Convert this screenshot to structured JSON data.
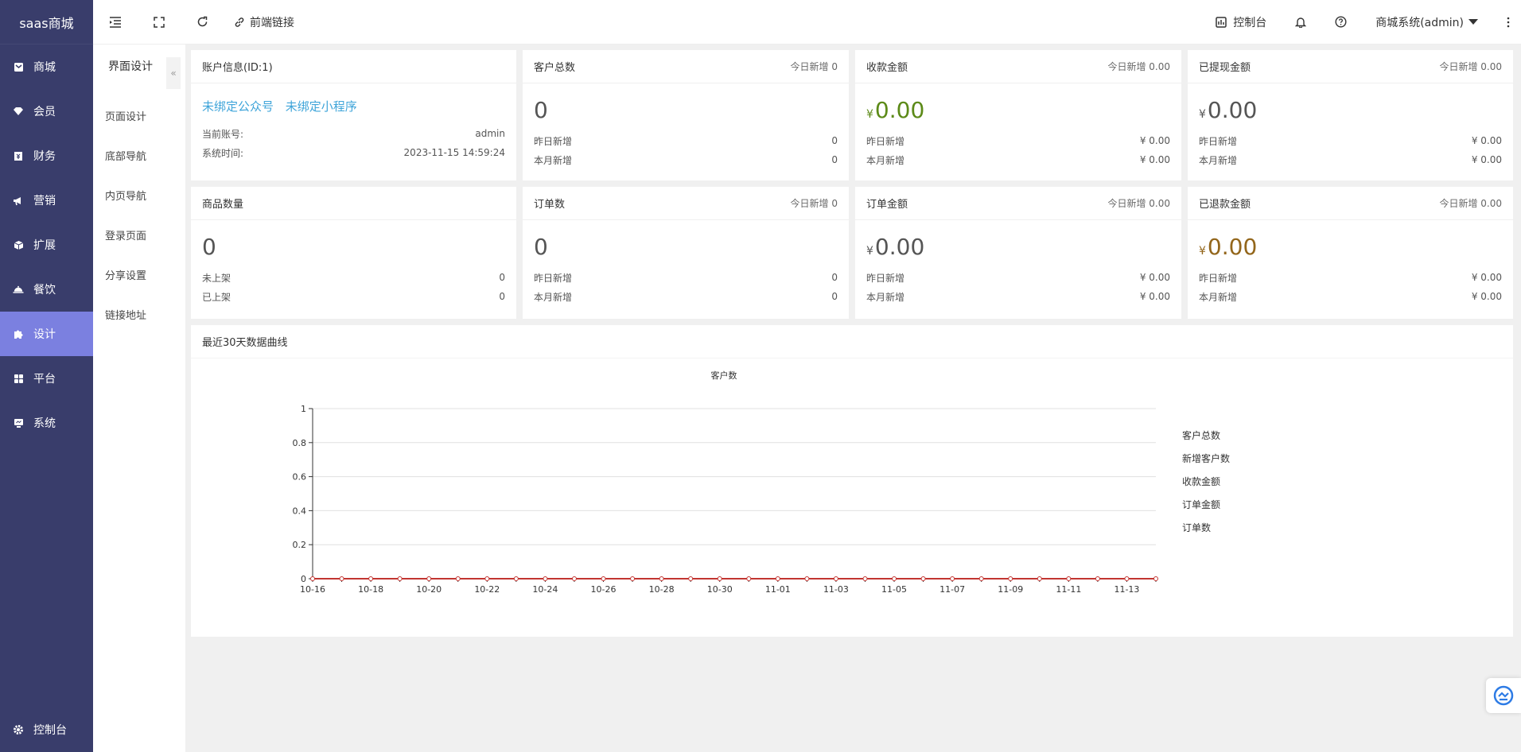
{
  "sidebar": {
    "logo": "saas商城",
    "items": [
      {
        "label": "商城",
        "icon": "mail-icon"
      },
      {
        "label": "会员",
        "icon": "gem-icon"
      },
      {
        "label": "财务",
        "icon": "money-icon"
      },
      {
        "label": "营销",
        "icon": "megaphone-icon"
      },
      {
        "label": "扩展",
        "icon": "cube-icon"
      },
      {
        "label": "餐饮",
        "icon": "dish-icon"
      },
      {
        "label": "设计",
        "icon": "puzzle-icon",
        "active": true
      },
      {
        "label": "平台",
        "icon": "grid-icon"
      },
      {
        "label": "系统",
        "icon": "monitor-icon"
      }
    ],
    "bottom": {
      "label": "控制台",
      "icon": "gear-icon"
    }
  },
  "header": {
    "frontend_link": "前端链接",
    "dashboard": "控制台",
    "user": "商城系统(admin)"
  },
  "subnav": {
    "title": "界面设计",
    "collapse": "«",
    "items": [
      "页面设计",
      "底部导航",
      "内页导航",
      "登录页面",
      "分享设置",
      "链接地址"
    ]
  },
  "cards": {
    "account": {
      "title": "账户信息(ID:1)",
      "link1": "未绑定公众号",
      "link2": "未绑定小程序",
      "row1_label": "当前账号:",
      "row1_value": "admin",
      "row2_label": "系统时间:",
      "row2_value": "2023-11-15 14:59:24"
    },
    "customers": {
      "title": "客户总数",
      "today": "今日新增 0",
      "value": "0",
      "r1": "昨日新增",
      "v1": "0",
      "r2": "本月新增",
      "v2": "0"
    },
    "income": {
      "title": "收款金额",
      "today": "今日新增 0.00",
      "cur": "¥",
      "value": "0.00",
      "r1": "昨日新增",
      "v1": "¥ 0.00",
      "r2": "本月新增",
      "v2": "¥ 0.00"
    },
    "withdrawn": {
      "title": "已提现金额",
      "today": "今日新增 0.00",
      "cur": "¥",
      "value": "0.00",
      "r1": "昨日新增",
      "v1": "¥ 0.00",
      "r2": "本月新增",
      "v2": "¥ 0.00"
    },
    "products": {
      "title": "商品数量",
      "value": "0",
      "r1": "未上架",
      "v1": "0",
      "r2": "已上架",
      "v2": "0"
    },
    "orders": {
      "title": "订单数",
      "today": "今日新增 0",
      "value": "0",
      "r1": "昨日新增",
      "v1": "0",
      "r2": "本月新增",
      "v2": "0"
    },
    "order_amount": {
      "title": "订单金额",
      "today": "今日新增 0.00",
      "cur": "¥",
      "value": "0.00",
      "r1": "昨日新增",
      "v1": "¥ 0.00",
      "r2": "本月新增",
      "v2": "¥ 0.00"
    },
    "refunded": {
      "title": "已退款金额",
      "today": "今日新增 0.00",
      "cur": "¥",
      "value": "0.00",
      "r1": "昨日新增",
      "v1": "¥ 0.00",
      "r2": "本月新增",
      "v2": "¥ 0.00"
    }
  },
  "chart_section": {
    "title": "最近30天数据曲线"
  },
  "chart_data": {
    "type": "line",
    "title": "客户数",
    "ylim": [
      0,
      1
    ],
    "yticks": [
      "0",
      "0.2",
      "0.4",
      "0.6",
      "0.8",
      "1"
    ],
    "x": [
      "10-16",
      "10-17",
      "10-18",
      "10-19",
      "10-20",
      "10-21",
      "10-22",
      "10-23",
      "10-24",
      "10-25",
      "10-26",
      "10-27",
      "10-28",
      "10-29",
      "10-30",
      "10-31",
      "11-01",
      "11-02",
      "11-03",
      "11-04",
      "11-05",
      "11-06",
      "11-07",
      "11-08",
      "11-09",
      "11-10",
      "11-11",
      "11-12",
      "11-13",
      "11-14"
    ],
    "xtick_labels": [
      "10-16",
      "10-18",
      "10-20",
      "10-22",
      "10-24",
      "10-26",
      "10-28",
      "10-30",
      "11-01",
      "11-03",
      "11-05",
      "11-07",
      "11-09",
      "11-11",
      "11-13"
    ],
    "series": [
      {
        "name": "客户总数",
        "values": [
          0,
          0,
          0,
          0,
          0,
          0,
          0,
          0,
          0,
          0,
          0,
          0,
          0,
          0,
          0,
          0,
          0,
          0,
          0,
          0,
          0,
          0,
          0,
          0,
          0,
          0,
          0,
          0,
          0,
          0
        ]
      },
      {
        "name": "新增客户数",
        "values": [
          0,
          0,
          0,
          0,
          0,
          0,
          0,
          0,
          0,
          0,
          0,
          0,
          0,
          0,
          0,
          0,
          0,
          0,
          0,
          0,
          0,
          0,
          0,
          0,
          0,
          0,
          0,
          0,
          0,
          0
        ]
      },
      {
        "name": "收款金额",
        "values": [
          0,
          0,
          0,
          0,
          0,
          0,
          0,
          0,
          0,
          0,
          0,
          0,
          0,
          0,
          0,
          0,
          0,
          0,
          0,
          0,
          0,
          0,
          0,
          0,
          0,
          0,
          0,
          0,
          0,
          0
        ]
      },
      {
        "name": "订单金额",
        "values": [
          0,
          0,
          0,
          0,
          0,
          0,
          0,
          0,
          0,
          0,
          0,
          0,
          0,
          0,
          0,
          0,
          0,
          0,
          0,
          0,
          0,
          0,
          0,
          0,
          0,
          0,
          0,
          0,
          0,
          0
        ]
      },
      {
        "name": "订单数",
        "values": [
          0,
          0,
          0,
          0,
          0,
          0,
          0,
          0,
          0,
          0,
          0,
          0,
          0,
          0,
          0,
          0,
          0,
          0,
          0,
          0,
          0,
          0,
          0,
          0,
          0,
          0,
          0,
          0,
          0,
          0
        ]
      }
    ],
    "line_color": "#c23531",
    "grid": true,
    "legend": "right"
  }
}
